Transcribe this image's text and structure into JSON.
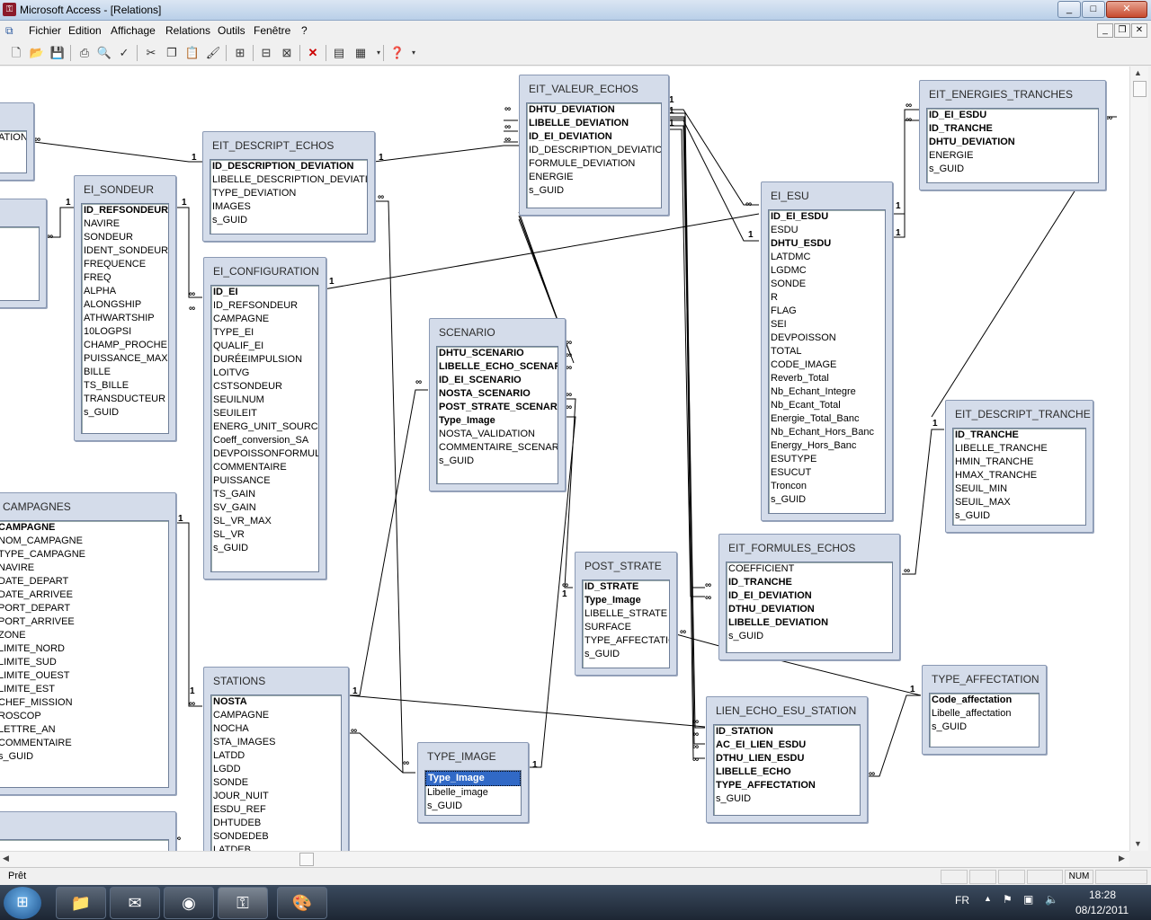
{
  "window": {
    "title": "Microsoft Access - [Relations]",
    "controls": [
      "_",
      "□",
      "✕"
    ]
  },
  "menu": [
    "Fichier",
    "Edition",
    "Affichage",
    "Relations",
    "Outils",
    "Fenêtre",
    "?"
  ],
  "mdi_controls": [
    "_",
    "❐",
    "✕"
  ],
  "toolbar_icons": [
    "new-icon",
    "open-icon",
    "save-icon",
    "print-icon",
    "print-preview-icon",
    "spelling-icon",
    "cut-icon",
    "copy-icon",
    "paste-icon",
    "format-painter-icon",
    "show-table-icon",
    "show-direct-icon",
    "show-all-icon",
    "delete-icon",
    "properties-icon",
    "new-object-icon",
    "help-icon"
  ],
  "tables": {
    "partial_top": {
      "title": "",
      "fields": [
        "ATION"
      ]
    },
    "partial_mid": {
      "title": "",
      "fields": []
    },
    "partial_bottom": {
      "title": "",
      "fields": []
    },
    "ei_sondeur": {
      "title": "EI_SONDEUR",
      "fields": [
        "ID_REFSONDEUR",
        "NAVIRE",
        "SONDEUR",
        "IDENT_SONDEUR",
        "FREQUENCE",
        "FREQ",
        "ALPHA",
        "ALONGSHIP",
        "ATHWARTSHIP",
        "10LOGPSI",
        "CHAMP_PROCHE",
        "PUISSANCE_MAX",
        "BILLE",
        "TS_BILLE",
        "TRANSDUCTEUR",
        "s_GUID"
      ],
      "pk": [
        0
      ]
    },
    "eit_descript_echos": {
      "title": "EIT_DESCRIPT_ECHOS",
      "fields": [
        "ID_DESCRIPTION_DEVIATION",
        "LIBELLE_DESCRIPTION_DEVIATION",
        "TYPE_DEVIATION",
        "IMAGES",
        "s_GUID"
      ],
      "pk": [
        0
      ]
    },
    "ei_configuration": {
      "title": "EI_CONFIGURATION",
      "fields": [
        "ID_EI",
        "ID_REFSONDEUR",
        "CAMPAGNE",
        "TYPE_EI",
        "QUALIF_EI",
        "DURÉEIMPULSION",
        "LOITVG",
        "CSTSONDEUR",
        "SEUILNUM",
        "SEUILEIT",
        "ENERG_UNIT_SOURCE",
        "Coeff_conversion_SA",
        "DEVPOISSONFORMULE",
        "COMMENTAIRE",
        "PUISSANCE",
        "TS_GAIN",
        "SV_GAIN",
        "SL_VR_MAX",
        "SL_VR",
        "s_GUID"
      ],
      "pk": [
        0
      ]
    },
    "eit_valeur_echos": {
      "title": "EIT_VALEUR_ECHOS",
      "fields": [
        "DHTU_DEVIATION",
        "LIBELLE_DEVIATION",
        "ID_EI_DEVIATION",
        "ID_DESCRIPTION_DEVIATION",
        "FORMULE_DEVIATION",
        "ENERGIE",
        "s_GUID"
      ],
      "pk": [
        0,
        1,
        2
      ]
    },
    "scenario": {
      "title": "SCENARIO",
      "fields": [
        "DHTU_SCENARIO",
        "LIBELLE_ECHO_SCENARIO",
        "ID_EI_SCENARIO",
        "NOSTA_SCENARIO",
        "POST_STRATE_SCENARIO",
        "Type_Image",
        "NOSTA_VALIDATION",
        "COMMENTAIRE_SCENARIO",
        "s_GUID"
      ],
      "pk": [
        0,
        1,
        2,
        3,
        4,
        5
      ]
    },
    "ei_esu": {
      "title": "EI_ESU",
      "fields": [
        "ID_EI_ESDU",
        "ESDU",
        "DHTU_ESDU",
        "LATDMC",
        "LGDMC",
        "SONDE",
        "R",
        "FLAG",
        "SEI",
        "DEVPOISSON",
        "TOTAL",
        "CODE_IMAGE",
        "Reverb_Total",
        "Nb_Echant_Integre",
        "Nb_Ecant_Total",
        "Energie_Total_Banc",
        "Nb_Echant_Hors_Banc",
        "Energy_Hors_Banc",
        "ESUTYPE",
        "ESUCUT",
        "Troncon",
        "s_GUID"
      ],
      "pk": [
        0,
        2
      ]
    },
    "eit_energies_tranches": {
      "title": "EIT_ENERGIES_TRANCHES",
      "fields": [
        "ID_EI_ESDU",
        "ID_TRANCHE",
        "DHTU_DEVIATION",
        "ENERGIE",
        "s_GUID"
      ],
      "pk": [
        0,
        1,
        2
      ]
    },
    "eit_descript_tranche": {
      "title": "EIT_DESCRIPT_TRANCHE",
      "fields": [
        "ID_TRANCHE",
        "LIBELLE_TRANCHE",
        "HMIN_TRANCHE",
        "HMAX_TRANCHE",
        "SEUIL_MIN",
        "SEUIL_MAX",
        "s_GUID"
      ],
      "pk": [
        0
      ]
    },
    "campagnes": {
      "title": "CAMPAGNES",
      "fields": [
        "CAMPAGNE",
        "NOM_CAMPAGNE",
        "TYPE_CAMPAGNE",
        "NAVIRE",
        "DATE_DEPART",
        "DATE_ARRIVEE",
        "PORT_DEPART",
        "PORT_ARRIVEE",
        "ZONE",
        "LIMITE_NORD",
        "LIMITE_SUD",
        "LIMITE_OUEST",
        "LIMITE_EST",
        "CHEF_MISSION",
        "ROSCOP",
        "LETTRE_AN",
        "COMMENTAIRE",
        "s_GUID"
      ],
      "pk": [
        0
      ]
    },
    "post_strate": {
      "title": "POST_STRATE",
      "fields": [
        "ID_STRATE",
        "Type_Image",
        "LIBELLE_STRATE",
        "SURFACE",
        "TYPE_AFFECTATIO",
        "s_GUID"
      ],
      "pk": [
        0,
        1
      ]
    },
    "eit_formules_echos": {
      "title": "EIT_FORMULES_ECHOS",
      "fields": [
        "COEFFICIENT",
        "ID_TRANCHE",
        "ID_EI_DEVIATION",
        "DTHU_DEVIATION",
        "LIBELLE_DEVIATION",
        "s_GUID"
      ],
      "pk": [
        1,
        2,
        3,
        4
      ]
    },
    "stations": {
      "title": "STATIONS",
      "fields": [
        "NOSTA",
        "CAMPAGNE",
        "NOCHA",
        "STA_IMAGES",
        "LATDD",
        "LGDD",
        "SONDE",
        "JOUR_NUIT",
        "ESDU_REF",
        "DHTUDEB",
        "SONDEDEB",
        "LATDEB"
      ],
      "pk": [
        0
      ]
    },
    "type_image": {
      "title": "TYPE_IMAGE",
      "fields": [
        "Type_Image",
        "Libelle_image",
        "s_GUID"
      ],
      "pk": [
        0
      ],
      "selected": [
        0
      ]
    },
    "lien_echo_esu_station": {
      "title": "LIEN_ECHO_ESU_STATION",
      "fields": [
        "ID_STATION",
        "AC_EI_LIEN_ESDU",
        "DTHU_LIEN_ESDU",
        "LIBELLE_ECHO",
        "TYPE_AFFECTATION",
        "s_GUID"
      ],
      "pk": [
        0,
        1,
        2,
        3,
        4
      ]
    },
    "type_affectation": {
      "title": "TYPE_AFFECTATION",
      "fields": [
        "Code_affectation",
        "Libelle_affectation",
        "s_GUID"
      ],
      "pk": [
        0
      ]
    }
  },
  "cardinality": {
    "one": "1",
    "many": "∞"
  },
  "statusbar": {
    "text": "Prêt",
    "num": "NUM"
  },
  "taskbar": {
    "apps": [
      "folder-icon",
      "mail-icon",
      "firefox-icon",
      "access-icon",
      "paint-icon"
    ],
    "lang": "FR",
    "time": "18:28",
    "date": "08/12/2011"
  }
}
